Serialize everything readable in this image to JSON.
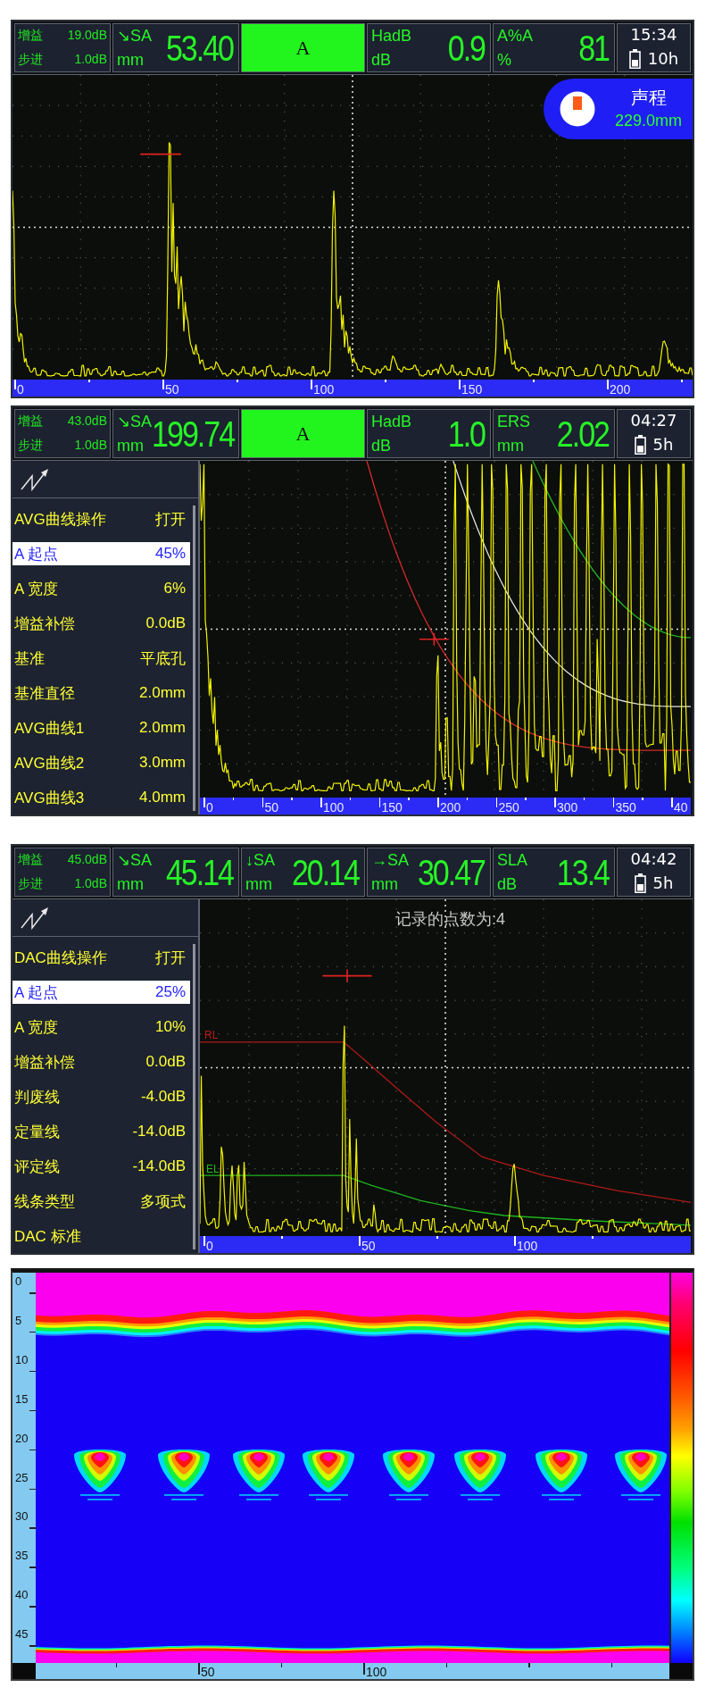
{
  "screens": [
    {
      "kind": "ascan",
      "header": {
        "gain": {
          "label": "增益",
          "value": "19.0dB"
        },
        "step": {
          "label": "步进",
          "value": "1.0dB"
        },
        "fields": [
          {
            "kind": "reading",
            "label": "↘SA",
            "unit": "mm",
            "value": "53.40"
          },
          {
            "kind": "gate",
            "label": "A"
          },
          {
            "kind": "reading",
            "label": "HadB",
            "unit": "dB",
            "value": "0.9"
          },
          {
            "kind": "reading",
            "label": "A%A",
            "unit": "%",
            "value": "81"
          }
        ],
        "clock": {
          "time": "15:34",
          "battery": "10h"
        }
      },
      "badge": {
        "label": "声程",
        "value": "229.0mm"
      },
      "x_axis": [
        "0",
        "50",
        "100",
        "150",
        "200"
      ]
    },
    {
      "kind": "ascan_menu",
      "header": {
        "gain": {
          "label": "增益",
          "value": "43.0dB"
        },
        "step": {
          "label": "步进",
          "value": "1.0dB"
        },
        "fields": [
          {
            "kind": "reading",
            "label": "↘SA",
            "unit": "mm",
            "value": "199.74"
          },
          {
            "kind": "gate",
            "label": "A"
          },
          {
            "kind": "reading",
            "label": "HadB",
            "unit": "dB",
            "value": "1.0"
          },
          {
            "kind": "reading",
            "label": "ERS",
            "unit": "mm",
            "value": "2.02"
          }
        ],
        "clock": {
          "time": "04:27",
          "battery": "5h"
        }
      },
      "menu": [
        {
          "label": "AVG曲线操作",
          "value": "打开",
          "selected": false
        },
        {
          "label": "A 起点",
          "value": "45%",
          "selected": true
        },
        {
          "label": "A 宽度",
          "value": "6%",
          "selected": false
        },
        {
          "label": "增益补偿",
          "value": "0.0dB",
          "selected": false
        },
        {
          "label": "基准",
          "value": "平底孔",
          "selected": false
        },
        {
          "label": "基准直径",
          "value": "2.0mm",
          "selected": false
        },
        {
          "label": "AVG曲线1",
          "value": "2.0mm",
          "selected": false
        },
        {
          "label": "AVG曲线2",
          "value": "3.0mm",
          "selected": false
        },
        {
          "label": "AVG曲线3",
          "value": "4.0mm",
          "selected": false
        }
      ],
      "x_axis": [
        "0",
        "50",
        "100",
        "150",
        "200",
        "250",
        "300",
        "350",
        "40"
      ]
    },
    {
      "kind": "ascan_menu",
      "header": {
        "gain": {
          "label": "增益",
          "value": "45.0dB"
        },
        "step": {
          "label": "步进",
          "value": "1.0dB"
        },
        "fields": [
          {
            "kind": "reading",
            "label": "↘SA",
            "unit": "mm",
            "value": "45.14"
          },
          {
            "kind": "reading",
            "label": "↓SA",
            "unit": "mm",
            "value": "20.14"
          },
          {
            "kind": "reading",
            "label": "→SA",
            "unit": "mm",
            "value": "30.47"
          },
          {
            "kind": "reading",
            "label": "SLA",
            "unit": "dB",
            "value": "13.4"
          }
        ],
        "clock": {
          "time": "04:42",
          "battery": "5h"
        }
      },
      "overlay_text": "记录的点数为:4",
      "curve_labels": [
        {
          "text": "RL",
          "color": "#b81c1c"
        },
        {
          "text": "EL",
          "color": "#22b822"
        }
      ],
      "menu": [
        {
          "label": "DAC曲线操作",
          "value": "打开",
          "selected": false
        },
        {
          "label": "A 起点",
          "value": "25%",
          "selected": true
        },
        {
          "label": "A 宽度",
          "value": "10%",
          "selected": false
        },
        {
          "label": "增益补偿",
          "value": "0.0dB",
          "selected": false
        },
        {
          "label": "判废线",
          "value": "-4.0dB",
          "selected": false
        },
        {
          "label": "定量线",
          "value": "-14.0dB",
          "selected": false
        },
        {
          "label": "评定线",
          "value": "-14.0dB",
          "selected": false
        },
        {
          "label": "线条类型",
          "value": "多项式",
          "selected": false
        },
        {
          "label": "DAC 标准",
          "selected": false
        }
      ],
      "x_axis": [
        "0",
        "50",
        "100"
      ]
    },
    {
      "kind": "bscan",
      "y_axis": [
        "0",
        "5",
        "10",
        "15",
        "20",
        "25",
        "30",
        "35",
        "40",
        "45"
      ],
      "x_axis": [
        "50",
        "100"
      ]
    }
  ]
}
